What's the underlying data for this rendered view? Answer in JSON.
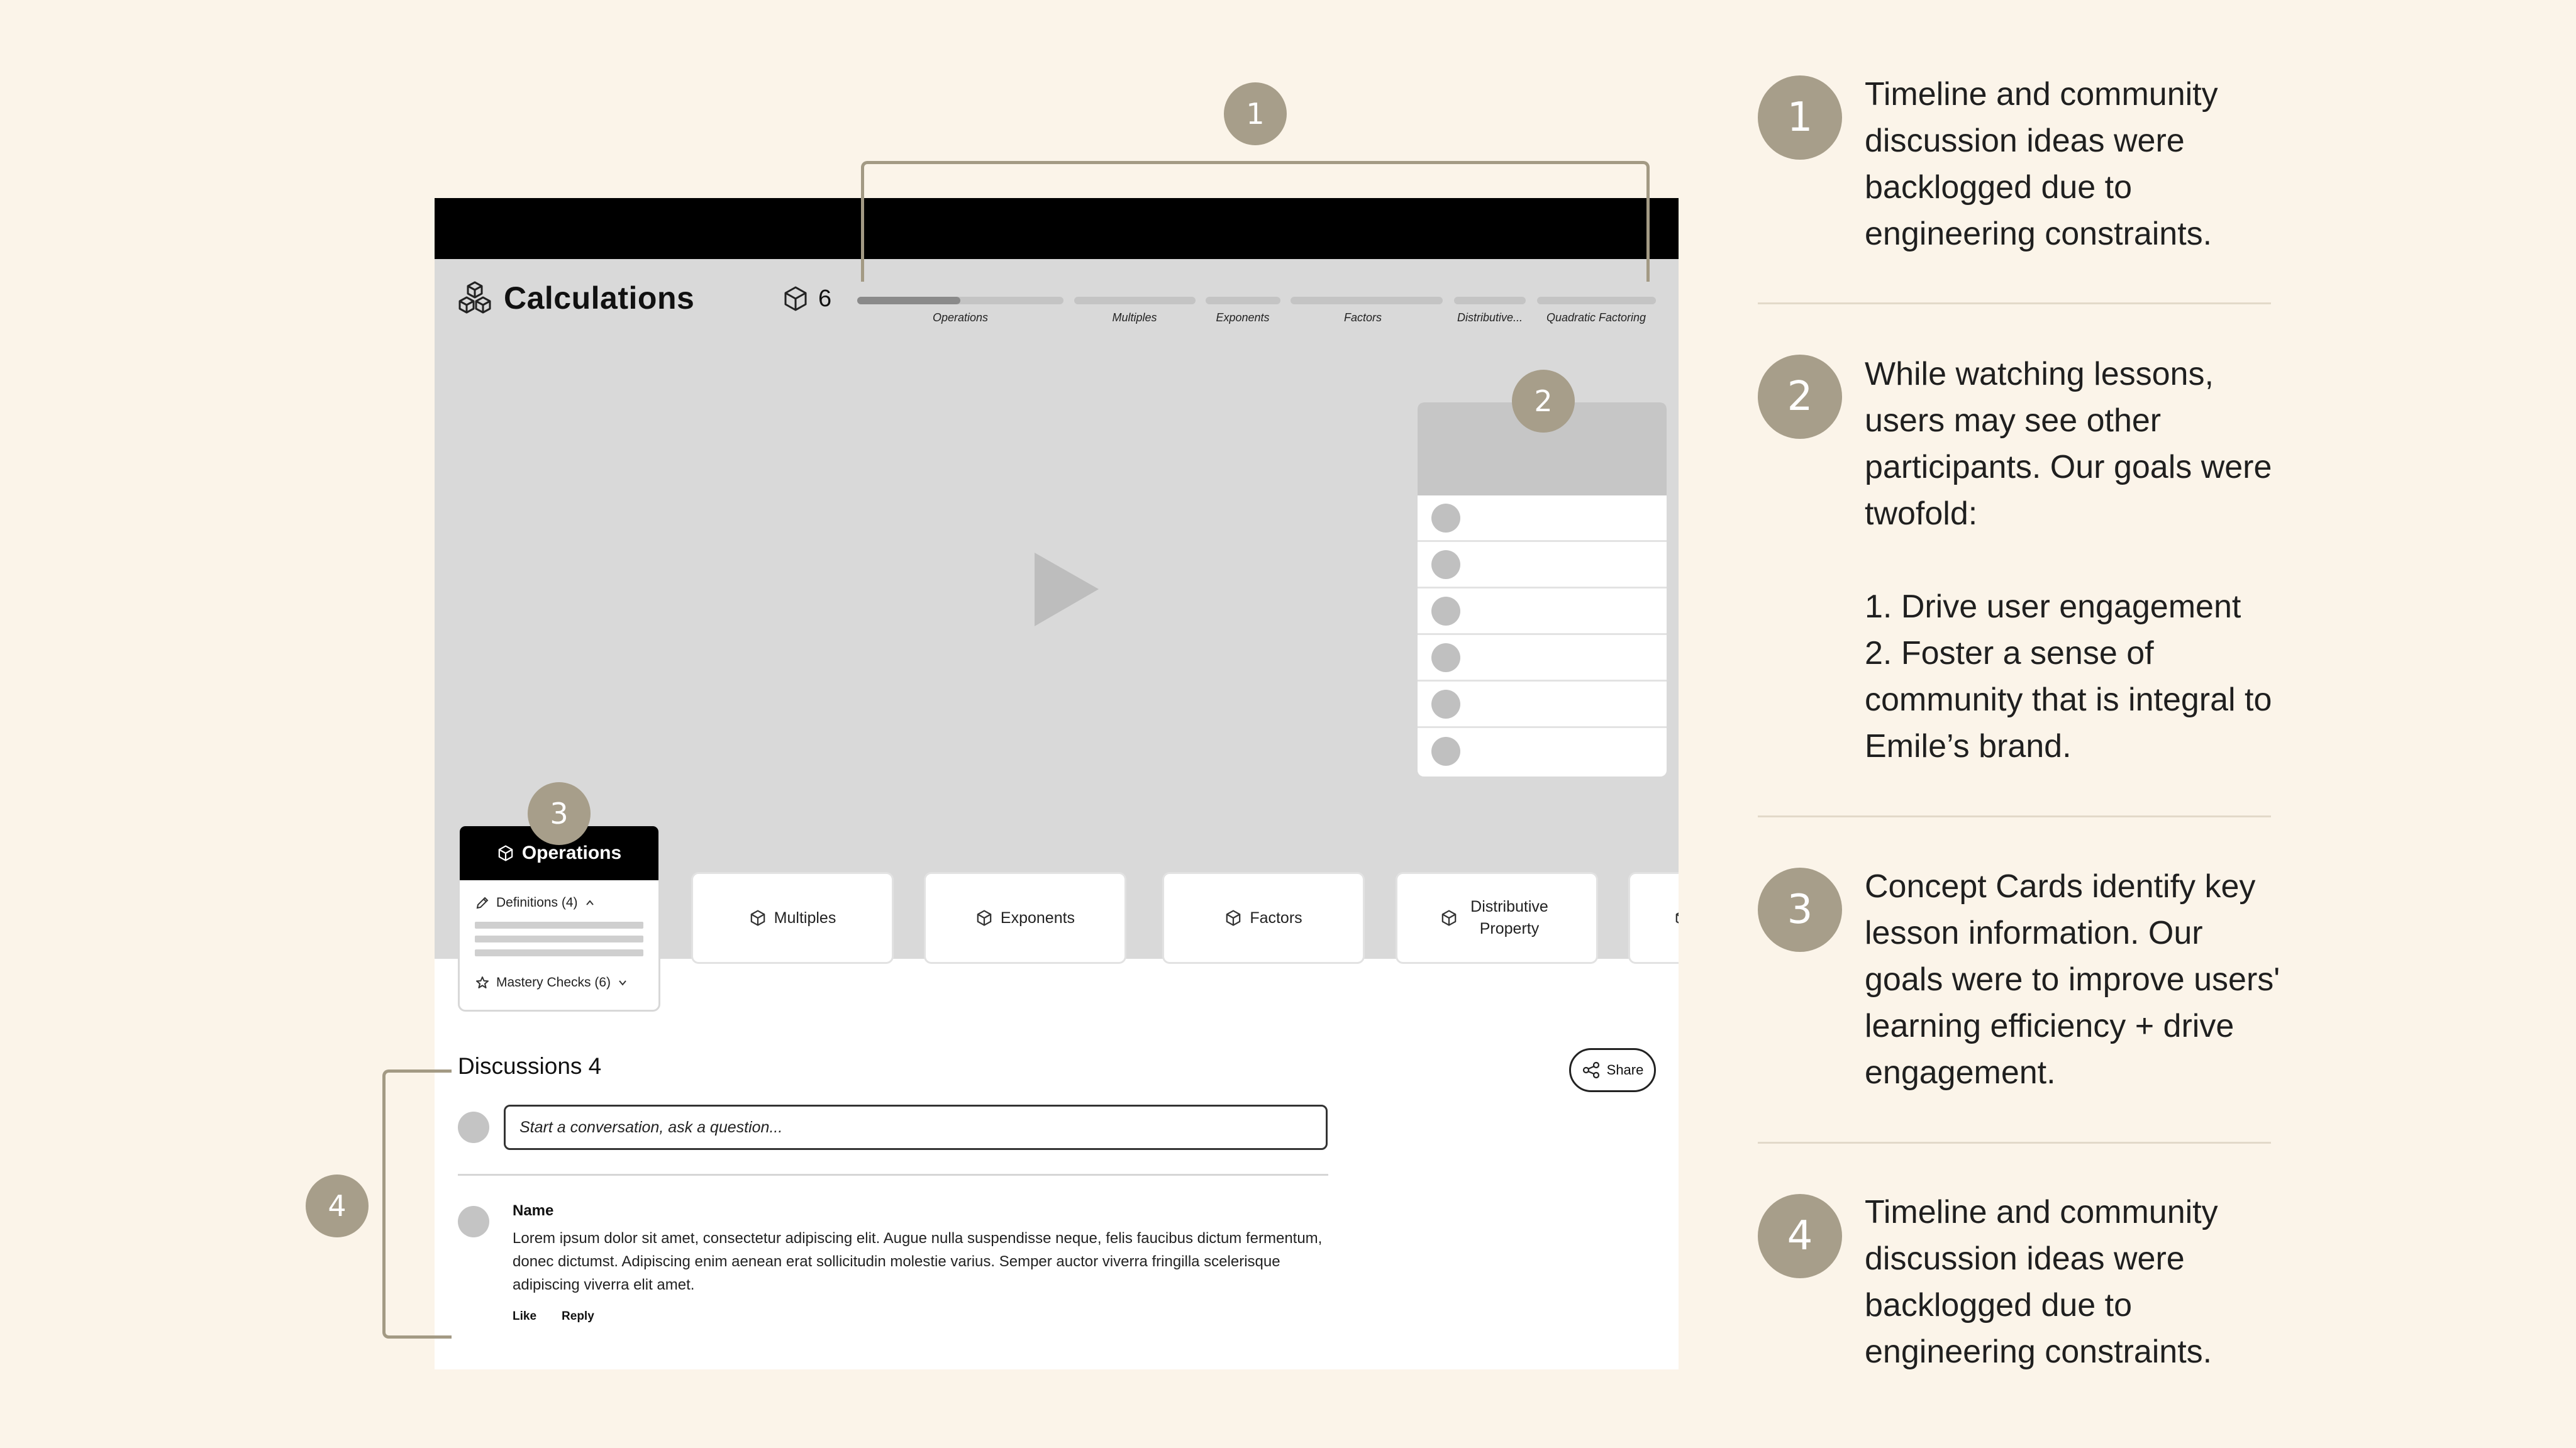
{
  "app": {
    "title": "Calculations",
    "cube_count": "6"
  },
  "timeline": {
    "labels": [
      "Operations",
      "Multiples",
      "Exponents",
      "Factors",
      "Distributive...",
      "Quadratic Factoring"
    ],
    "progress_fraction_first": 0.5
  },
  "concept_cards": {
    "active": {
      "title": "Operations",
      "definitions": "Definitions (4)",
      "mastery": "Mastery Checks (6)"
    },
    "others": [
      "Multiples",
      "Exponents",
      "Factors",
      "Distributive Property"
    ]
  },
  "discussions": {
    "title": "Discussions 4",
    "share_label": "Share",
    "input_placeholder": "Start a conversation, ask a question...",
    "comment": {
      "name": "Name",
      "body": "Lorem ipsum dolor sit amet, consectetur adipiscing elit. Augue nulla suspendisse neque, felis faucibus dictum fermentum, donec dictumst. Adipiscing enim aenean erat sollicitudin molestie varius. Semper auctor viverra fringilla scelerisque adipiscing viverra elit amet.",
      "like_label": "Like",
      "reply_label": "Reply"
    }
  },
  "callouts": [
    "1",
    "2",
    "3",
    "4"
  ],
  "notes": [
    {
      "number": "1",
      "text": "Timeline and community discussion ideas were backlogged due to engineering constraints."
    },
    {
      "number": "2",
      "text": "While watching lessons, users may see other participants. Our goals were twofold:\n\n1. Drive user engagement\n2. Foster a sense of community that is integral to Emile’s brand."
    },
    {
      "number": "3",
      "text": "Concept Cards identify key lesson information. Our goals were to improve users' learning efficiency + drive engagement."
    },
    {
      "number": "4",
      "text": "Timeline and community discussion ideas were backlogged due to engineering constraints."
    }
  ],
  "colors": {
    "background": "#FBF4E9",
    "badge": "#A79E8A",
    "bracket": "#A39A84",
    "hero": "#D9D9D9"
  },
  "icons": [
    "logo-cubes-icon",
    "cube-icon",
    "play-icon",
    "pencil-icon",
    "chevron-up-icon",
    "star-icon",
    "chevron-down-icon",
    "share-icon"
  ]
}
